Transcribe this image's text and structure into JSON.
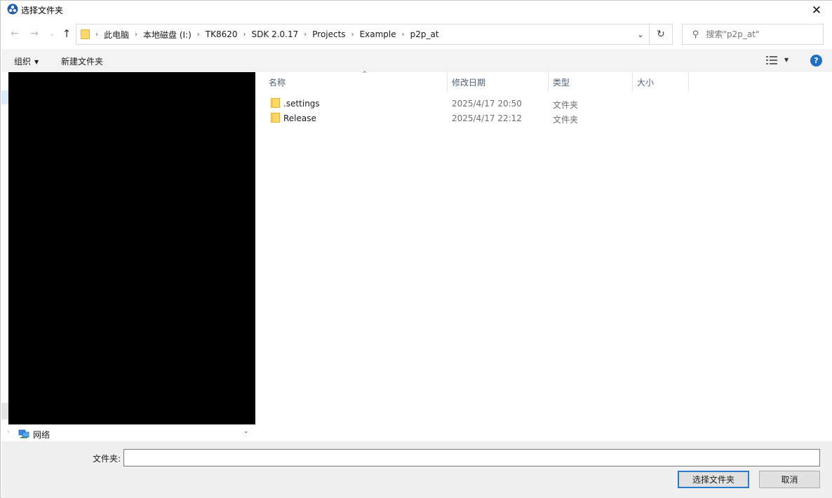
{
  "window": {
    "title": "选择文件夹",
    "close_glyph": "✕"
  },
  "nav": {
    "back_glyph": "←",
    "forward_glyph": "→",
    "recent_glyph": "⌄",
    "up_glyph": "↑",
    "breadcrumbs": [
      "此电脑",
      "本地磁盘 (I:)",
      "TK8620",
      "SDK 2.0.17",
      "Projects",
      "Example",
      "p2p_at"
    ],
    "crumb_sep": "›",
    "dropdown_glyph": "⌄",
    "refresh_glyph": "↻",
    "search_placeholder": "搜索\"p2p_at\"",
    "search_glyph": "⚲"
  },
  "toolbar": {
    "organize": "组织",
    "organize_caret": "▼",
    "new_folder": "新建文件夹",
    "view_caret": "▼",
    "help": "?"
  },
  "navpane": {
    "network_label": "网络",
    "expand_glyph": "›",
    "scroll_down_glyph": "⌄"
  },
  "filelist": {
    "columns": [
      {
        "label": "名称"
      },
      {
        "label": "修改日期"
      },
      {
        "label": "类型"
      },
      {
        "label": "大小"
      }
    ],
    "sort_glyph": "^",
    "rows": [
      {
        "name": ".settings",
        "date": "2025/4/17 20:50",
        "type": "文件夹"
      },
      {
        "name": "Release",
        "date": "2025/4/17 22:12",
        "type": "文件夹"
      }
    ]
  },
  "footer": {
    "folder_label": "文件夹:",
    "folder_value": "",
    "select_button": "选择文件夹",
    "cancel_button": "取消"
  },
  "colors": {
    "accent": "#2a7bd0",
    "folder": "#ffd86a",
    "help": "#1f6fc5"
  }
}
